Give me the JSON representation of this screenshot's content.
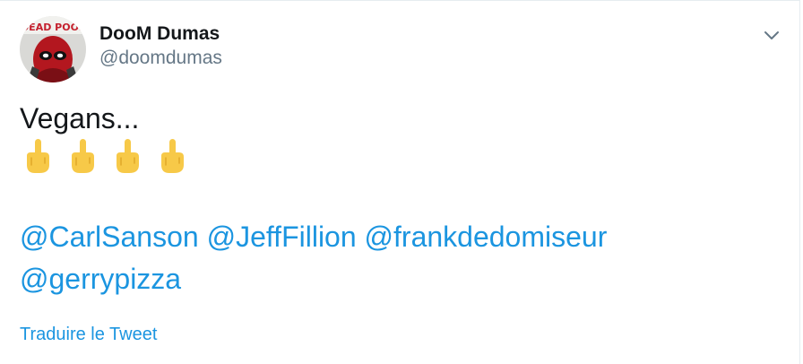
{
  "author": {
    "display_name": "DooM Dumas",
    "handle": "@doomdumas",
    "avatar_text": "DEAD POOL"
  },
  "tweet": {
    "text": "Vegans...",
    "emoji": [
      "middle-finger-emoji",
      "middle-finger-emoji",
      "middle-finger-emoji",
      "middle-finger-emoji"
    ],
    "mentions": [
      "@CarlSanson",
      "@JeffFillion",
      "@frankdedomiseur",
      "@gerrypizza"
    ]
  },
  "actions": {
    "translate_label": "Traduire le Tweet",
    "menu_icon": "chevron-down-icon"
  },
  "colors": {
    "link": "#1b95e0",
    "secondary_text": "#657786",
    "primary_text": "#14171a",
    "emoji_yellow": "#f7c948"
  }
}
